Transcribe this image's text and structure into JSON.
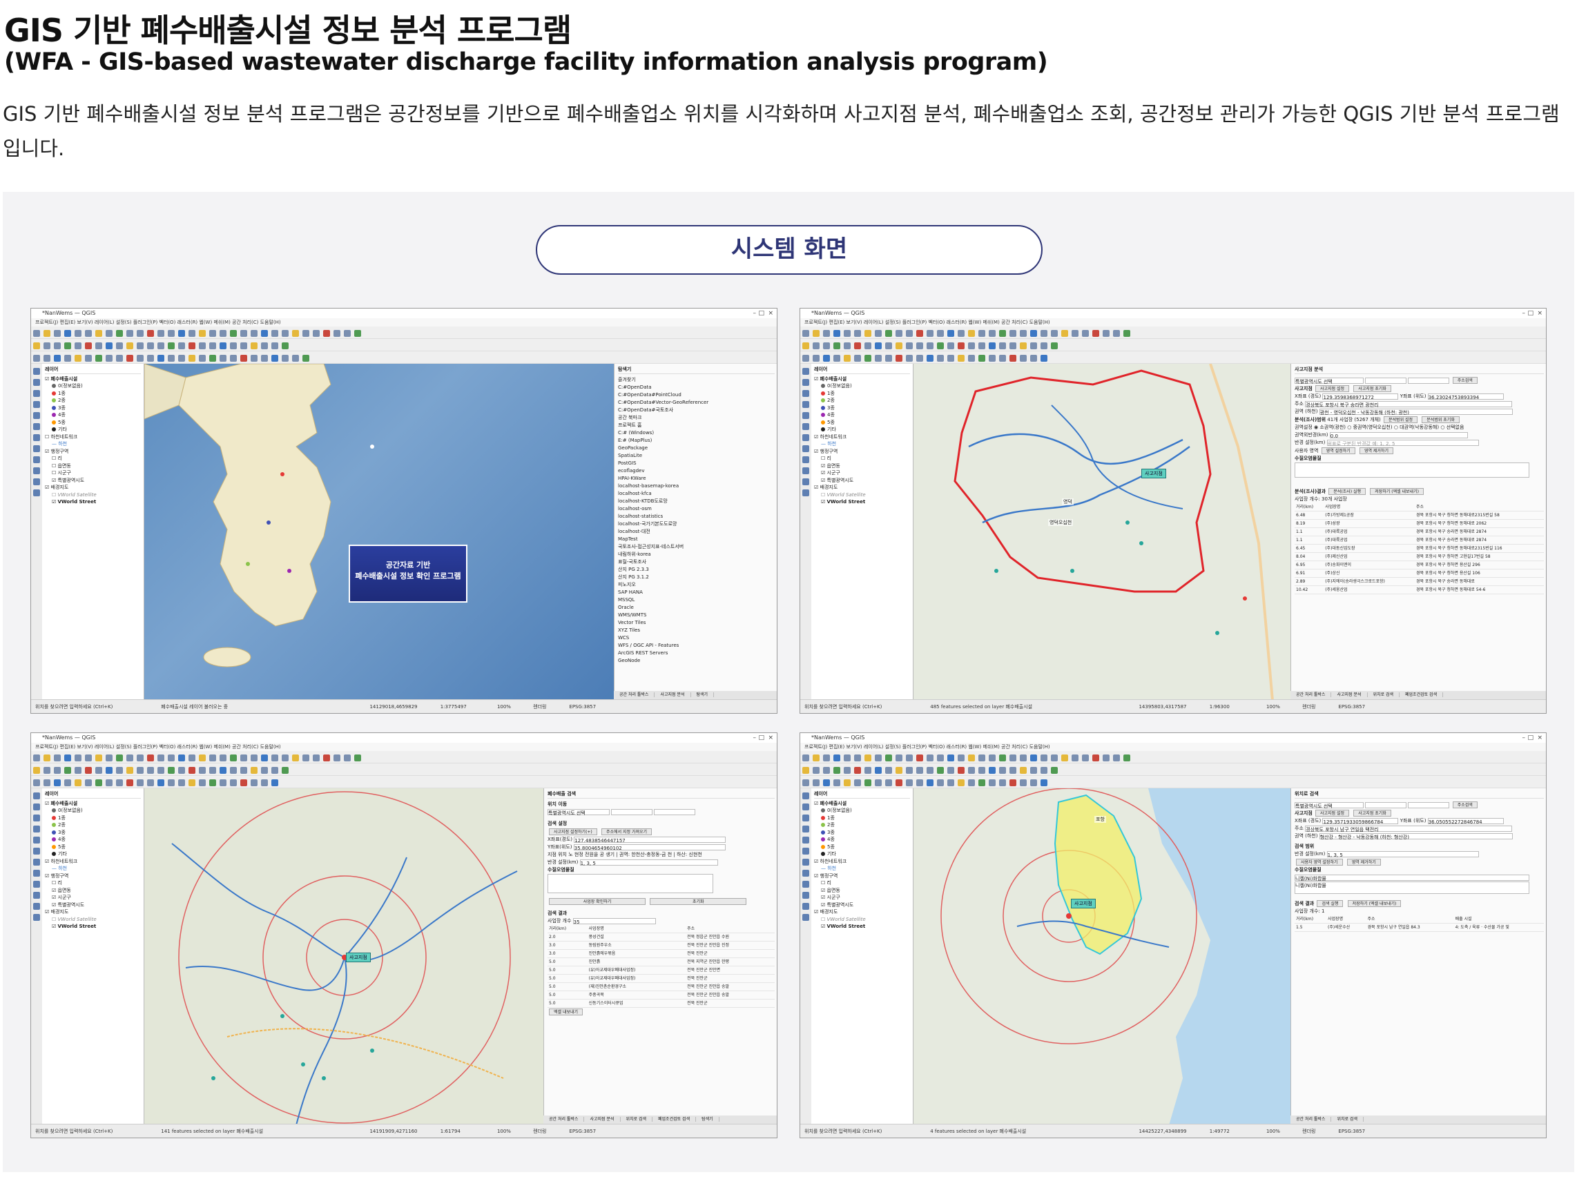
{
  "header": {
    "title": "GIS 기반 폐수배출시설 정보 분석 프로그램",
    "subtitle": "(WFA - GIS-based wastewater discharge facility information analysis program)",
    "description": "GIS 기반 폐수배출시설 정보 분석 프로그램은 공간정보를 기반으로 폐수배출업소 위치를 시각화하며 사고지점 분석, 폐수배출업소 조회, 공간정보 관리가 가능한 QGIS 기반 분석 프로그램 입니다."
  },
  "section": {
    "label": "시스템 화면"
  },
  "screens": {
    "common": {
      "menu": "프로젝트(J) 편집(E) 보기(V) 레이어(L) 설정(S) 플러그인(P) 벡터(O) 래스터(R) 웹(W) 메쉬(M) 공간 처리(C) 도움말(H)",
      "layers_header": "레이어",
      "layer_wastewater": "폐수배출시설",
      "layer_grades": [
        "0(정보없음)",
        "1종",
        "2종",
        "3종",
        "4종",
        "5종",
        "기타"
      ],
      "layer_stream": "하천네트워크",
      "layer_stream_sub": "하천",
      "layer_admin": "행정구역",
      "layer_admin_items": [
        "리",
        "읍면동",
        "시군구",
        "특별광역시도"
      ],
      "layer_base": "배경지도",
      "layer_satellite": "VWorld Satellite",
      "layer_street": "VWorld Street",
      "search_placeholder": "위치를 찾으려면 입력하세요 (Ctrl+K)",
      "crs": "EPSG:3857",
      "render_label": "렌더링"
    },
    "screen1": {
      "window_title": "*NanWems — QGIS",
      "splash_line1": "공간자료 기반",
      "splash_line2": "폐수배출시설 정보 확인 프로그램",
      "browser_header": "탐색기",
      "browser_items": [
        "즐겨찾기",
        "C:#OpenData",
        "C:#OpenData#PointCloud",
        "C:#OpenData#Vector-GeoReferencer",
        "C:#OpenData#국토조사",
        "공간 북마크",
        "프로젝트 홈",
        "C:# (Windows)",
        "E:# (MapPlus)",
        "GeoPackage",
        "SpatiaLite",
        "PostGIS",
        "ecoflagdev",
        "HPAI-KWare",
        "localhost-basemap-korea",
        "localhost-kfca",
        "localhost-KTDB도로망",
        "localhost-osm",
        "localhost-statistics",
        "localhost-국가기본도도로망",
        "localhost-대전",
        "MapTest",
        "국토조사-접근성지표-테스트서버",
        "내림하위-korea",
        "표릴-국토조사",
        "산지 PG 2.3.3",
        "산지 PG 3.1.2",
        "피노지오",
        "SAP HANA",
        "MSSQL",
        "Oracle",
        "WMS/WMTS",
        "Vector Tiles",
        "XYZ Tiles",
        "WCS",
        "WFS / OGC API - Features",
        "ArcGIS REST Servers",
        "GeoNode"
      ],
      "status_msg": "폐수배출시설 레이어 불러오는 중",
      "scale": "1:3775497",
      "zoom": "100%",
      "coord": "14129018,4659829",
      "tabs": [
        "공간 처리 툴박스",
        "사고지점 분석",
        "탐색기"
      ]
    },
    "screen2": {
      "window_title": "*NanWems — QGIS",
      "panel_title": "사고지점 분석",
      "sido_select": "특별광역시도 선택",
      "search_btn": "주소검색",
      "accident_point": "사고지점",
      "set_point_btn": "사고지점 설정",
      "reset_btn": "사고지점 초기화",
      "x_label": "X좌표 (경도)",
      "x_value": "129.3598368971272",
      "y_label": "Y좌표 (위도)",
      "y_value": "36.23024753893394",
      "address_label": "주소",
      "address_value": "경상북도 포항시 북구 송라면 광천리",
      "area_label": "권역 (하천)",
      "area_value": "광천 - 영덕오십천 - 낙동강동해 (하천: 광천)",
      "analysis_label": "분석(조사)범위",
      "analysis_value": "41개 사업장 (5267 개체)",
      "analysis_set_btn": "분석범위 설정",
      "analysis_reset_btn": "분석범위 초기화",
      "region_label": "권역설정",
      "region_opt1": "소권역(광천)",
      "region_opt2": "중권역(영덕오십천)",
      "region_opt3": "대권역(낙동강동해)",
      "region_opt4": "선택없음",
      "dist_label": "권역외반경(km)",
      "dist_value": "0.0",
      "radius_label": "반경 설정(km)",
      "radius_hint": "쉼표로 구분된 반경값 예: 1, 2, 5",
      "user_area_label": "사용자 영역",
      "user_area_btn": "영역 설정하기",
      "user_area_clear": "영역 제거하기",
      "water_label": "수질오염물질",
      "result_label": "분석(조사)결과",
      "run_btn": "분석(조사) 실행",
      "save_btn": "저장하기 (엑셀 내보내기)",
      "count_label": "사업장 개수",
      "count_value": "30개 사업장",
      "table_headers": [
        "거리(km)",
        "사업장명",
        "주소"
      ],
      "rows": [
        [
          "6.48",
          "(주)가방제1공장",
          "경북 포항시 북구 청하면 동해대로2315번길 58"
        ],
        [
          "8.19",
          "(주)성광",
          "경북 포항시 북구 청하면 동해대로 2062"
        ],
        [
          "1.1",
          "(주)대륙공업",
          "경북 포항시 북구 송라면 동해대로 2874"
        ],
        [
          "1.1",
          "(주)대륙공업",
          "경북 포항시 북구 송라면 동해대로 2874"
        ],
        [
          "6.45",
          "(주)대동신업도장",
          "경북 포항시 북구 청하면 동해대로2315번길 116"
        ],
        [
          "8.04",
          "(주)제신산업",
          "경북 포항시 북구 청하면 고현길17번길 58"
        ],
        [
          "6.95",
          "(주)송화이엔이",
          "경북 포항시 북구 청하면 용산길 296"
        ],
        [
          "6.91",
          "(주)상신",
          "경북 포항시 북구 청하면 용산길 106"
        ],
        [
          "2.89",
          "(주)지에이(송라생극스크로드포항)",
          "경북 포항시 북구 송라면 동해대로"
        ],
        [
          "10.42",
          "(주)세웅산업",
          "경북 포항시 북구 청하면 동해대로 54-6"
        ]
      ],
      "map_label_city": "영덕",
      "map_label_region": "영덕오십천",
      "accident_tag": "사고지점",
      "status_msg": "485 features selected on layer 폐수배출시설",
      "scale": "1:96300",
      "zoom": "100%",
      "coord": "14395803,4317587",
      "tabs": [
        "공간 처리 툴박스",
        "사고지점 분석",
        "위치로 검색",
        "폐업조건검토 검색"
      ]
    },
    "screen3": {
      "window_title": "*NanWems — QGIS",
      "panel_title": "폐수배출 검색",
      "location_label": "위치 이동",
      "sido_select": "특별광역시도 선택",
      "search_setting": "검색 설정",
      "set_point_btn": "사고지점 설정하기(+)",
      "addr_btn": "주소에서 지정 가져오기",
      "x_label": "X좌표(경도)",
      "x_value": "127.4838546447157",
      "y_label": "Y좌표(위도)",
      "y_value": "35.8004654960102",
      "pos_label": "지점 위치",
      "pos_value": "노 현정 전원을 공 생기 | 권역: 한천산-충정동-금 천 | 하산: 신현천",
      "radius_label": "반경 설정(km)",
      "radius_value": "1, 3, 5",
      "water_label": "수질오염물질",
      "search_btn": "사업장 확인하기",
      "reset_btn": "초기화",
      "result_label": "검색 결과",
      "count_label": "사업장 개수",
      "count_value": "35",
      "table_headers": [
        "거리(km)",
        "사업장명",
        "주소"
      ],
      "rows": [
        [
          "2.0",
          "풍성건설",
          "전북 정읍군 진안읍 수원"
        ],
        [
          "3.0",
          "동림원주우소",
          "전북 진안군 진안읍 진정"
        ],
        [
          "3.0",
          "진안흙에우볶음",
          "전북 진안군"
        ],
        [
          "5.0",
          "진안흙",
          "전북 지역군 진안읍 한평"
        ],
        [
          "5.0",
          "(유)아교제대우폐대사업정)",
          "전북 진안군 진안면"
        ],
        [
          "5.0",
          "(유)아교제대우폐대사업정)",
          "전북 진안군"
        ],
        [
          "5.0",
          "(재)진안촌순환경구소",
          "전북 진안군 진안읍 송말"
        ],
        [
          "5.0",
          "주중곡북",
          "전북 진안군 진안읍 송말"
        ],
        [
          "5.0",
          "신동기스이터시큐업",
          "전북 진안군"
        ]
      ],
      "export_btn": "엑셀 내보내기",
      "accident_tag": "사고지점",
      "status_msg": "141 features selected on layer 폐수배출시설",
      "scale": "1:61794",
      "zoom": "100%",
      "coord": "14191909,4271160",
      "tabs": [
        "공간 처리 툴박스",
        "사고지점 분석",
        "위치로 검색",
        "폐업조건검토 검색",
        "탐색기"
      ]
    },
    "screen4": {
      "window_title": "*NanWems — QGIS",
      "panel_title": "위치로 검색",
      "sido_select": "특별광역시도 선택",
      "search_btn": "주소검색",
      "accident_point": "사고지점",
      "set_point_btn": "사고지점 설정",
      "reset_btn": "사고지점 초기화",
      "x_label": "X좌표 (경도)",
      "x_value": "129.3571933059866784",
      "y_label": "Y좌표 (위도)",
      "y_value": "36.050552272846784",
      "address_label": "주소",
      "address_value": "경상북도 포항시 남구 연일읍 택전리",
      "area_label": "권역 (하천)",
      "area_value": "형산강 - 형산강 - 낙동강동해 (하천: 형산강)",
      "search_range": "검색 범위",
      "radius_label": "반경 설정(km)",
      "radius_value": "1, 3, 5",
      "user_area_btn": "사용자 영역 설정하기",
      "user_area_clear": "영역 제거하기",
      "water_label": "수질오염물질",
      "water_item1": "니켈(Ni)화합물",
      "water_item2": "니켈(Ni)화합물",
      "result_label": "검색 결과",
      "run_btn": "검색 실행",
      "save_btn": "저장하기 (엑셀 내보내기)",
      "count_label": "사업장 개수",
      "count_value": "1",
      "table_headers": [
        "거리(km)",
        "사업장명",
        "주소",
        "배출 시설"
      ],
      "rows": [
        [
          "1.5",
          "(주)세운수산",
          "경북 포항시 남구 연일읍 84.3",
          "4: 도축 / 육류 · 수산물 가공 및"
        ]
      ],
      "map_label_city": "포항",
      "accident_tag": "사고지점",
      "status_msg": "4 features selected on layer 폐수배출시설",
      "scale": "1:49772",
      "zoom": "100%",
      "coord": "14425227,4348899",
      "tabs": [
        "공간 처리 툴박스",
        "위치로 검색"
      ]
    }
  },
  "colors": {
    "accent": "#2e3576",
    "grade1": "#e53935",
    "grade2": "#8bc34a",
    "grade3": "#3f51b5",
    "grade4": "#9c27b0",
    "grade5": "#ff9800",
    "river": "#3a78c9",
    "boundary": "#e0242a",
    "buffer": "#e06060",
    "selection": "#f2ef6a"
  }
}
